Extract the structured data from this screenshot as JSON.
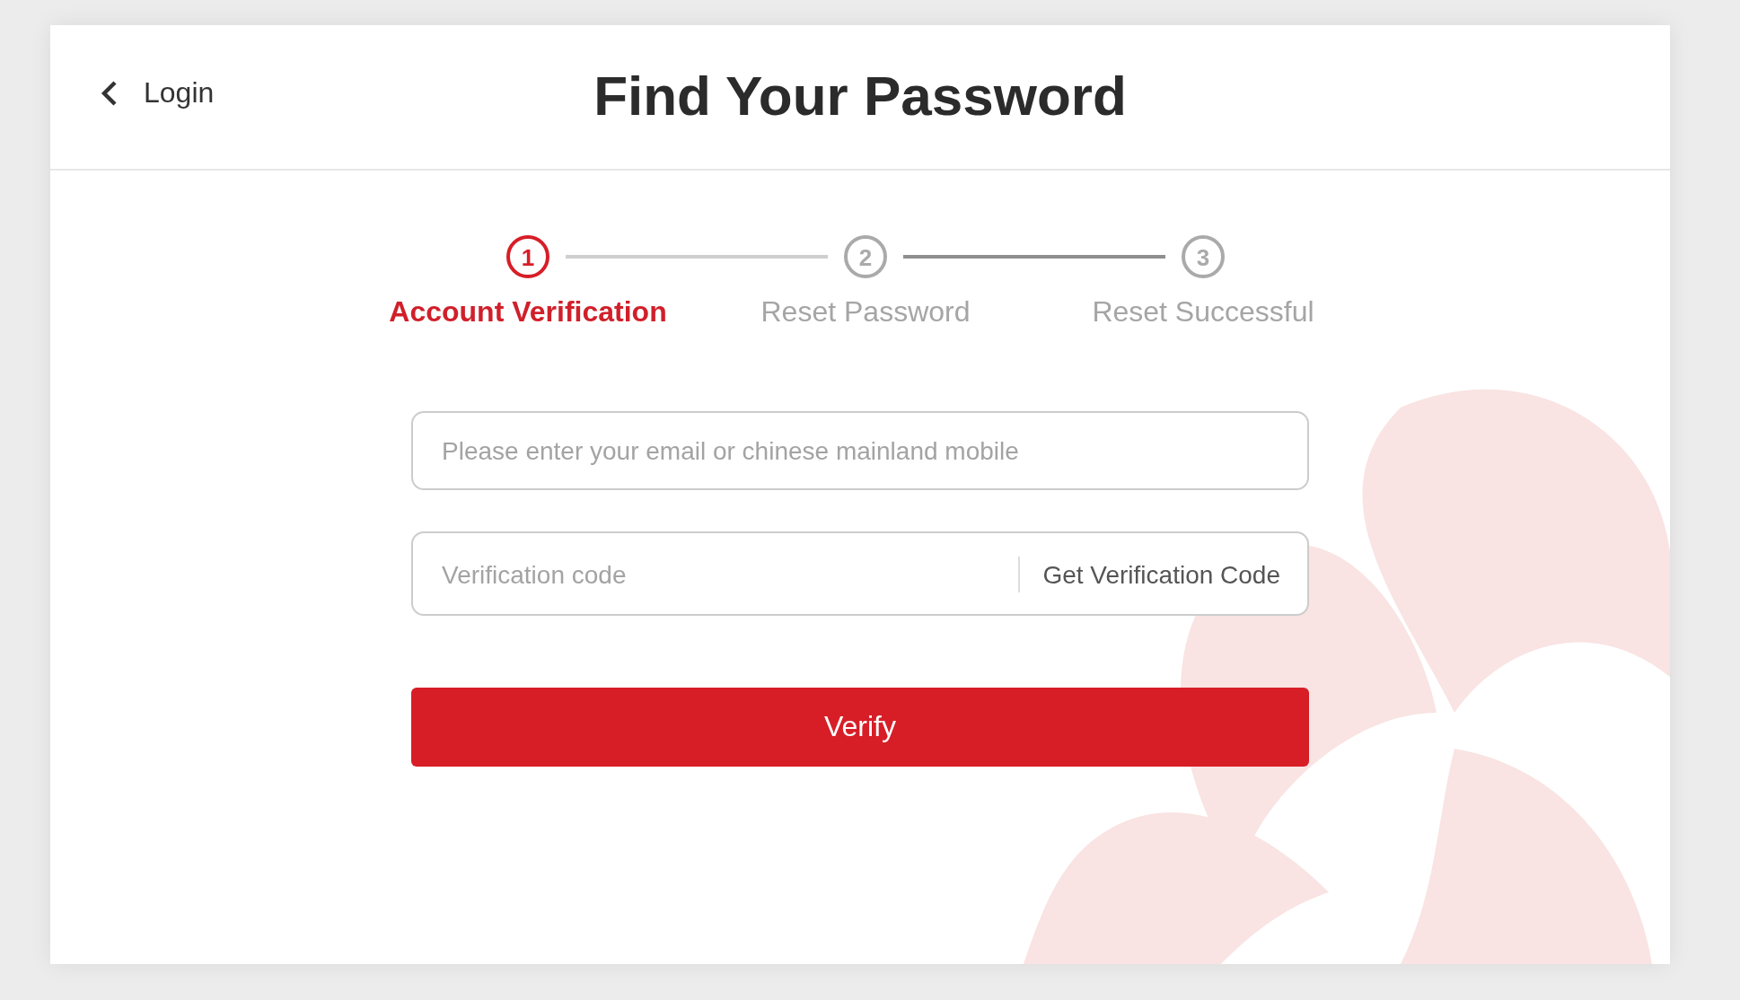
{
  "header": {
    "back_label": "Login",
    "title": "Find Your Password"
  },
  "steps": [
    {
      "number": "1",
      "label": "Account Verification",
      "selected": true
    },
    {
      "number": "2",
      "label": "Reset Password",
      "selected": false
    },
    {
      "number": "3",
      "label": "Reset Successful",
      "selected": false
    }
  ],
  "form": {
    "account_placeholder": "Please enter your email or chinese mainland mobile",
    "code_placeholder": "Verification code",
    "get_code_label": "Get Verification Code",
    "submit_label": "Verify"
  }
}
